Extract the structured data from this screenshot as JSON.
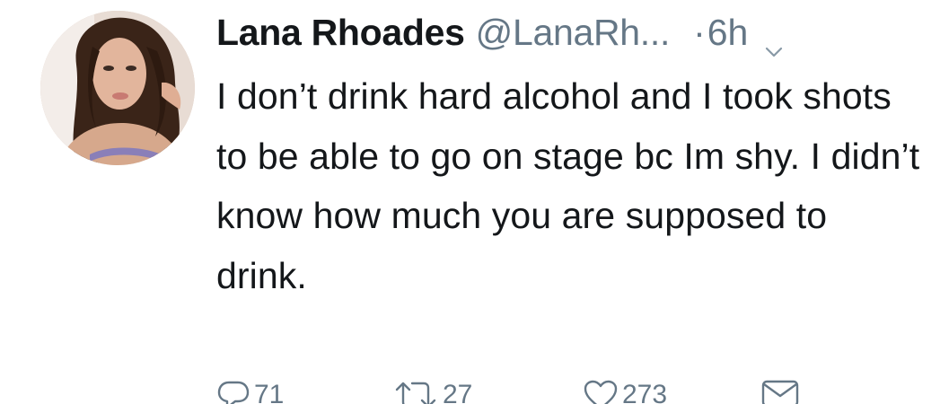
{
  "tweet": {
    "author_name": "Lana Rhoades",
    "handle": "@LanaRh...",
    "dot": "·",
    "time": "6h",
    "text": "I don’t drink hard alcohol and I took shots to be able to go on stage bc Im shy. I didn’t know how much you are supposed to drink.",
    "reply_count": "71",
    "retweet_count": "27",
    "like_count": "273"
  },
  "icons": {
    "avatar": "profile-photo",
    "caret": "chevron-down-icon",
    "reply": "reply-icon",
    "retweet": "retweet-icon",
    "like": "heart-icon",
    "message": "envelope-icon"
  },
  "colors": {
    "text": "#14171a",
    "secondary": "#657786"
  }
}
